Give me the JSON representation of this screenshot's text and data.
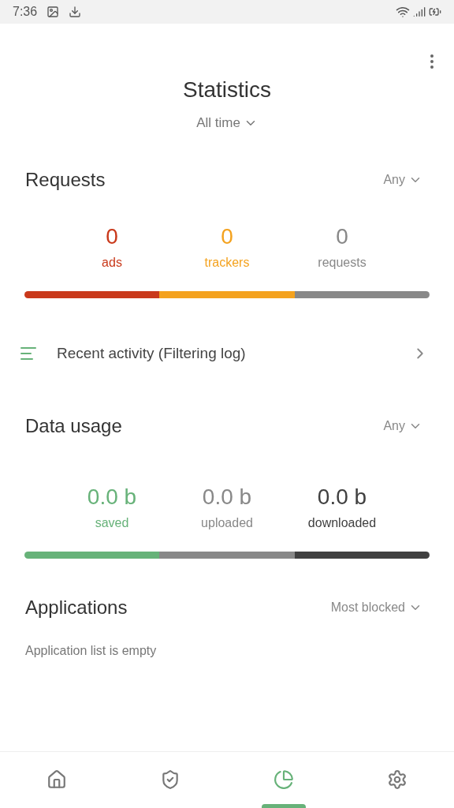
{
  "status_bar": {
    "time": "7:36"
  },
  "title": "Statistics",
  "period": "All time",
  "requests": {
    "title": "Requests",
    "filter": "Any",
    "stats": [
      {
        "value": "0",
        "label": "ads",
        "color": "#c9391b"
      },
      {
        "value": "0",
        "label": "trackers",
        "color": "#f4a21e"
      },
      {
        "value": "0",
        "label": "requests",
        "color": "#888888"
      }
    ]
  },
  "recent_activity": "Recent activity (Filtering log)",
  "data_usage": {
    "title": "Data usage",
    "filter": "Any",
    "stats": [
      {
        "value": "0.0 b",
        "label": "saved",
        "color": "#67b279"
      },
      {
        "value": "0.0 b",
        "label": "uploaded",
        "color": "#888888"
      },
      {
        "value": "0.0 b",
        "label": "downloaded",
        "color": "#404040"
      }
    ]
  },
  "applications": {
    "title": "Applications",
    "filter": "Most blocked",
    "empty_text": "Application list is empty"
  },
  "nav": [
    {
      "kind": "home",
      "selected": false
    },
    {
      "kind": "shield",
      "selected": false
    },
    {
      "kind": "stats",
      "selected": true
    },
    {
      "kind": "settings",
      "selected": false
    }
  ]
}
